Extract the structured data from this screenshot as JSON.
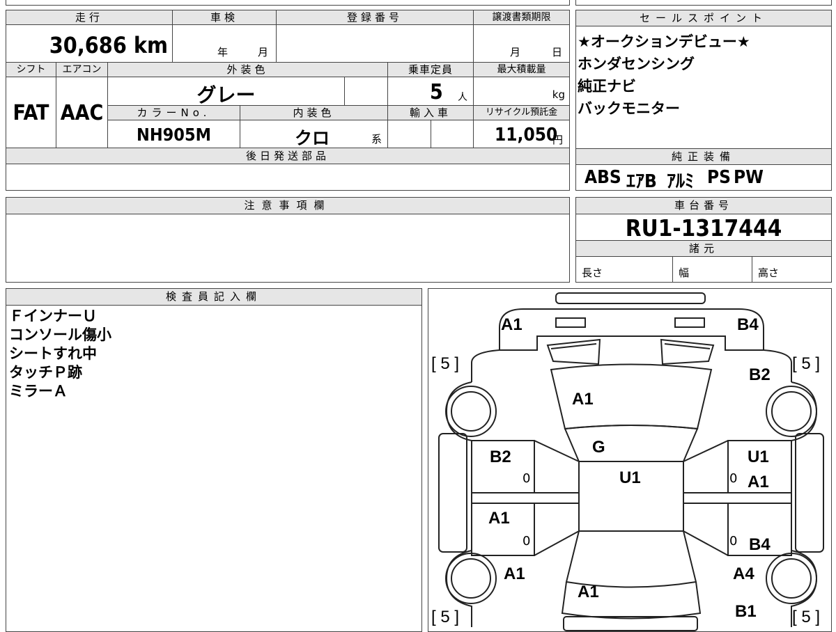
{
  "top_info": {
    "mileage_label": "走行",
    "mileage": "30,686 km",
    "shaken_label": "車検",
    "shaken_year": "年",
    "shaken_month": "月",
    "reg_label": "登録番号",
    "transfer_label": "譲渡書類期限",
    "transfer_month": "月",
    "transfer_day": "日",
    "shift_label": "シフト",
    "shift": "FAT",
    "ac_label": "エアコン",
    "ac": "AAC",
    "ext_color_label": "外装色",
    "ext_color": "グレー",
    "capacity_label": "乗車定員",
    "capacity": "5",
    "capacity_unit": "人",
    "max_load_label": "最大積載量",
    "max_load_unit": "kg",
    "color_no_label": "カラーNo.",
    "color_no": "NH905M",
    "int_color_label": "内装色",
    "int_color": "クロ",
    "int_color_suffix": "系",
    "import_label": "輸入車",
    "recycle_label": "リサイクル預託金",
    "recycle": "11,050",
    "recycle_unit": "円",
    "later_parts_label": "後日発送部品"
  },
  "sales_points": {
    "label": "セールスポイント",
    "items": [
      "★オークションデビュー★",
      "ホンダセンシング",
      "純正ナビ",
      "バックモニター"
    ]
  },
  "equipment": {
    "label": "純正装備",
    "items": [
      "ABS",
      "ｴｱB",
      "ｱﾙﾐ",
      "PS",
      "PW"
    ]
  },
  "notes": {
    "label": "注意事項欄"
  },
  "chassis": {
    "label": "車台番号",
    "value": "RU1-1317444"
  },
  "specs": {
    "label": "諸元",
    "length": "長さ",
    "width": "幅",
    "height": "高さ"
  },
  "inspector": {
    "label": "検査員記入欄",
    "lines": [
      "ＦインナーＵ",
      "コンソール傷小",
      "シートすれ中",
      "タッチＰ跡",
      "ミラーＡ"
    ]
  },
  "diagram": {
    "damage_marks": [
      "A1",
      "B4",
      "B2",
      "A1",
      "G",
      "B2",
      "U1",
      "U1",
      "A1",
      "A1",
      "B4",
      "A1",
      "A4",
      "A1",
      "B1"
    ],
    "tire_marks": [
      "[ 5 ]",
      "[ 5 ]",
      "[ 5 ]",
      "[ 5 ]"
    ],
    "small_zeros": [
      "0",
      "0",
      "0",
      "0"
    ]
  }
}
